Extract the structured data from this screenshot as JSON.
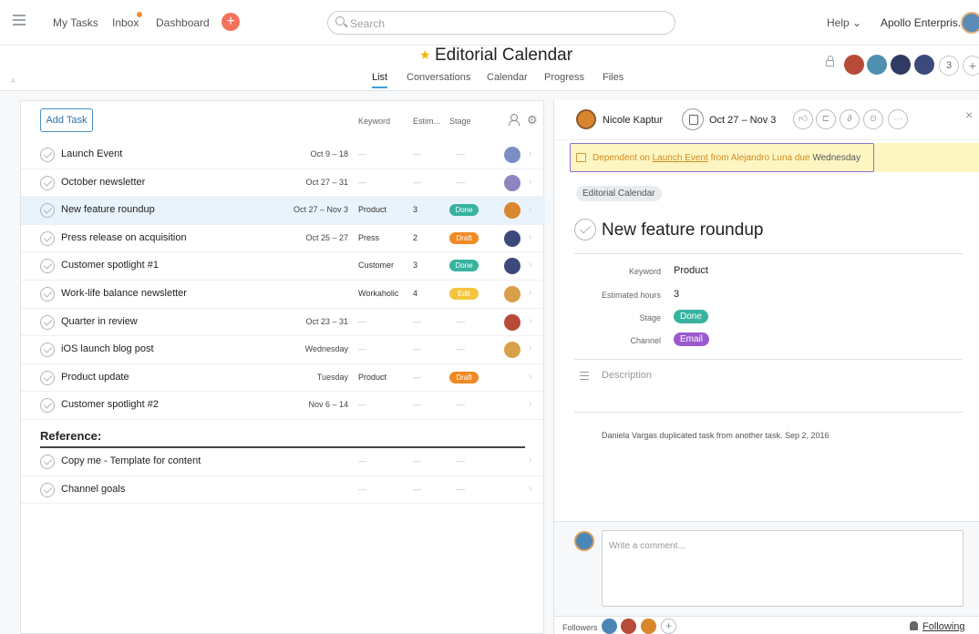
{
  "topbar": {
    "nav": [
      "My Tasks",
      "Inbox",
      "Dashboard"
    ],
    "add_label": "+",
    "search_placeholder": "Search",
    "help": "Help ⌄",
    "org": "Apollo Enterpris..."
  },
  "header": {
    "title": "Editorial Calendar",
    "chevron": "⌄",
    "tabs": [
      "List",
      "Conversations",
      "Calendar",
      "Progress",
      "Files"
    ],
    "active_tab": "List",
    "member_count": "3",
    "member_add": "+",
    "corner_mark": "A"
  },
  "list": {
    "add_task": "Add Task",
    "columns": [
      "Keyword",
      "Estim...",
      "Stage"
    ],
    "tasks": [
      {
        "name": "Launch Event",
        "date": "Oct 9 – 18",
        "keyword": "—",
        "est": "—",
        "stage": "—",
        "stage_color": "",
        "avatar": "#7b8fc6"
      },
      {
        "name": "October newsletter",
        "date": "Oct 27 – 31",
        "keyword": "—",
        "est": "—",
        "stage": "—",
        "stage_color": "",
        "avatar": "#8e84c0"
      },
      {
        "name": "New feature roundup",
        "date": "Oct 27 – Nov 3",
        "keyword": "Product",
        "est": "3",
        "stage": "Done",
        "stage_color": "#37b3a0",
        "avatar": "#d9862f"
      },
      {
        "name": "Press release on acquisition",
        "date": "Oct 25 – 27",
        "keyword": "Press",
        "est": "2",
        "stage": "Draft",
        "stage_color": "#f08a24",
        "avatar": "#3b4a7a"
      },
      {
        "name": "Customer spotlight #1",
        "date": "",
        "keyword": "Customer",
        "est": "3",
        "stage": "Done",
        "stage_color": "#37b3a0",
        "avatar": "#3b4a7a"
      },
      {
        "name": "Work-life balance newsletter",
        "date": "",
        "keyword": "Workaholic",
        "est": "4",
        "stage": "Edit",
        "stage_color": "#f2c53d",
        "avatar": "#d9a04a"
      },
      {
        "name": "Quarter in review",
        "date": "Oct 23 – 31",
        "keyword": "—",
        "est": "—",
        "stage": "—",
        "stage_color": "",
        "avatar": "#b84a3a"
      },
      {
        "name": "iOS launch blog post",
        "date": "Wednesday",
        "keyword": "—",
        "est": "—",
        "stage": "—",
        "stage_color": "",
        "avatar": "#d9a04a"
      },
      {
        "name": "Product update",
        "date": "Tuesday",
        "keyword": "Product",
        "est": "—",
        "stage": "Draft",
        "stage_color": "#f08a24",
        "avatar": ""
      },
      {
        "name": "Customer spotlight #2",
        "date": "Nov 6 – 14",
        "keyword": "—",
        "est": "—",
        "stage": "—",
        "stage_color": "",
        "avatar": ""
      }
    ],
    "section": "Reference:",
    "reference_tasks": [
      {
        "name": "Copy me - Template for content",
        "date": "",
        "keyword": "—",
        "est": "—",
        "stage": "—",
        "stage_color": "",
        "avatar": ""
      },
      {
        "name": "Channel goals",
        "date": "",
        "keyword": "—",
        "est": "—",
        "stage": "—",
        "stage_color": "",
        "avatar": ""
      }
    ]
  },
  "detail": {
    "assignee": "Nicole Kaptur",
    "due": "Oct 27 – Nov 3",
    "close": "×",
    "dependency": {
      "prefix": "Dependent on ",
      "task": "Launch Event",
      "middle": " from Alejandro Luna due ",
      "due": "Wednesday"
    },
    "project": "Editorial Calendar",
    "title": "New feature roundup",
    "fields": [
      {
        "label": "Keyword",
        "value": "Product"
      },
      {
        "label": "Estimated hours",
        "value": "3"
      },
      {
        "label": "Stage",
        "value": "Done",
        "color": "#37b3a0"
      },
      {
        "label": "Channel",
        "value": "Email",
        "color": "#9b59d0"
      }
    ],
    "description_placeholder": "Description",
    "activity": "Daniela Vargas duplicated task from another task.  Sep 2, 2016",
    "comment_placeholder": "Write a comment...",
    "followers_label": "Followers",
    "followers_add": "+",
    "following": "Following"
  },
  "colors": {
    "accent": "#36a1d7",
    "done": "#37b3a0",
    "draft": "#f08a24",
    "edit": "#f2c53d",
    "email": "#9b59d0",
    "dependency_border": "#8a6fd3"
  }
}
